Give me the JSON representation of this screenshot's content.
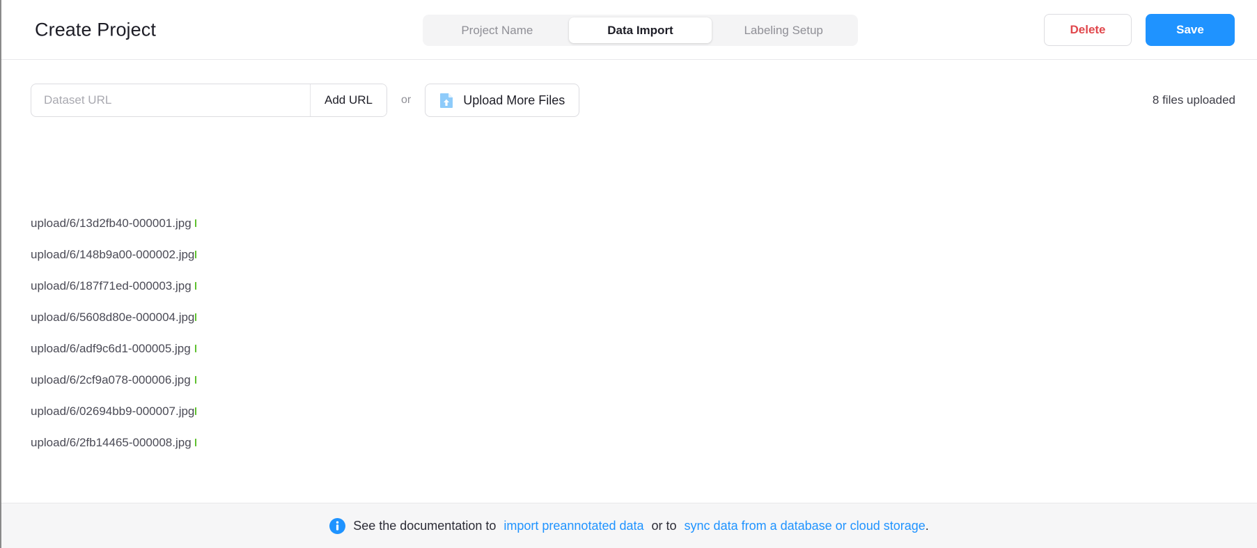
{
  "header": {
    "title": "Create Project",
    "tabs": [
      {
        "label": "Project Name",
        "active": false
      },
      {
        "label": "Data Import",
        "active": true
      },
      {
        "label": "Labeling Setup",
        "active": false
      }
    ],
    "delete_label": "Delete",
    "save_label": "Save",
    "accent_color": "#1f93ff",
    "danger_color": "#e0474c"
  },
  "import": {
    "url_placeholder": "Dataset URL",
    "url_value": "",
    "add_url_label": "Add URL",
    "or_label": "or",
    "upload_label": "Upload More Files",
    "upload_icon": "file-upload-icon",
    "files_uploaded_label": "8 files uploaded"
  },
  "files": [
    {
      "name": "upload/6/13d2fb40-000001.jpg",
      "progress": 100
    },
    {
      "name": "upload/6/148b9a00-000002.jpg",
      "progress": 100
    },
    {
      "name": "upload/6/187f71ed-000003.jpg",
      "progress": 100
    },
    {
      "name": "upload/6/5608d80e-000004.jpg",
      "progress": 100
    },
    {
      "name": "upload/6/adf9c6d1-000005.jpg",
      "progress": 100
    },
    {
      "name": "upload/6/2cf9a078-000006.jpg",
      "progress": 100
    },
    {
      "name": "upload/6/02694bb9-000007.jpg",
      "progress": 100
    },
    {
      "name": "upload/6/2fb14465-000008.jpg",
      "progress": 100
    }
  ],
  "progress_color": "#7ed957",
  "footer": {
    "icon": "info-circle-icon",
    "text_before": "See the documentation to",
    "link1": "import preannotated data",
    "text_middle": "or to",
    "link2": "sync data from a database or cloud storage",
    "text_end": "."
  }
}
